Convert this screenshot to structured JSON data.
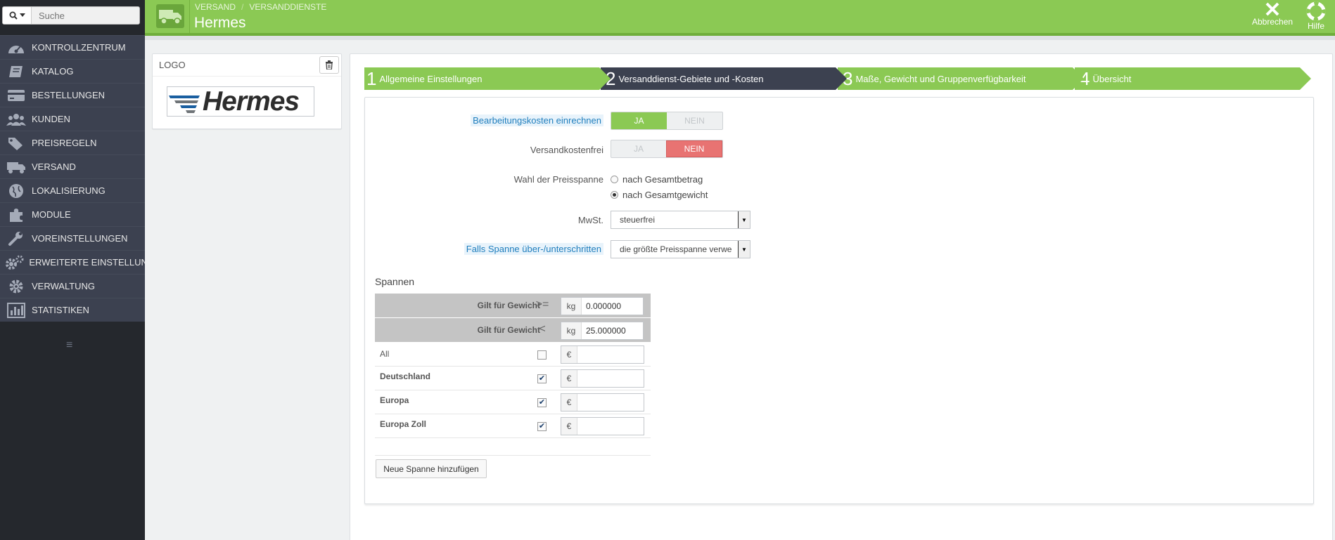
{
  "search": {
    "placeholder": "Suche"
  },
  "sidebar": {
    "items": [
      {
        "label": "KONTROLLZENTRUM",
        "icon": "dashboard-icon"
      },
      {
        "label": "KATALOG",
        "icon": "book-icon"
      },
      {
        "label": "BESTELLUNGEN",
        "icon": "credit-card-icon"
      },
      {
        "label": "KUNDEN",
        "icon": "users-icon"
      },
      {
        "label": "PREISREGELN",
        "icon": "tags-icon"
      },
      {
        "label": "VERSAND",
        "icon": "truck-icon"
      },
      {
        "label": "LOKALISIERUNG",
        "icon": "globe-icon"
      },
      {
        "label": "MODULE",
        "icon": "puzzle-icon"
      },
      {
        "label": "VOREINSTELLUNGEN",
        "icon": "wrench-icon"
      },
      {
        "label": "ERWEITERTE EINSTELLUN...",
        "icon": "cogs-icon"
      },
      {
        "label": "VERWALTUNG",
        "icon": "cog-icon"
      },
      {
        "label": "STATISTIKEN",
        "icon": "bar-chart-icon"
      }
    ]
  },
  "header": {
    "breadcrumb": [
      "VERSAND",
      "VERSANDDIENSTE"
    ],
    "title": "Hermes",
    "cancel_label": "Abbrechen",
    "help_label": "Hilfe"
  },
  "logo_panel": {
    "title": "LOGO",
    "logo_text": "Hermes"
  },
  "wizard": {
    "steps": [
      {
        "number": "1",
        "label": "Allgemeine Einstellungen"
      },
      {
        "number": "2",
        "label": "Versanddienst-Gebiete und -Kosten"
      },
      {
        "number": "3",
        "label": "Maße, Gewicht und Gruppenverfügbarkeit"
      },
      {
        "number": "4",
        "label": "Übersicht"
      }
    ],
    "active_step": 2
  },
  "form": {
    "handling_label": "Bearbeitungskosten einrechnen",
    "free_label": "Versandkostenfrei",
    "yes": "JA",
    "no": "NEIN",
    "handling_value": "JA",
    "free_value": "NEIN",
    "range_label": "Wahl der Preisspanne",
    "range_options": [
      "nach Gesamtbetrag",
      "nach Gesamtgewicht"
    ],
    "range_selected": "nach Gesamtgewicht",
    "tax_label": "MwSt.",
    "tax_value": "steuerfrei",
    "outofrange_label": "Falls Spanne über-/unterschritten",
    "outofrange_value": "die größte Preisspanne verwe"
  },
  "ranges": {
    "section_title": "Spannen",
    "header_rows": [
      {
        "label": "Gilt für Gewicht",
        "operator": ">=",
        "unit": "kg",
        "value": "0.000000"
      },
      {
        "label": "Gilt für Gewicht",
        "operator": "<",
        "unit": "kg",
        "value": "25.000000"
      }
    ],
    "zones": [
      {
        "name": "All",
        "checked": false,
        "currency": "€"
      },
      {
        "name": "Deutschland",
        "checked": true,
        "currency": "€"
      },
      {
        "name": "Europa",
        "checked": true,
        "currency": "€"
      },
      {
        "name": "Europa Zoll",
        "checked": true,
        "currency": "€"
      }
    ],
    "add_button": "Neue Spanne hinzufügen"
  },
  "colors": {
    "accent_green": "#8bc954",
    "active_step": "#3c4150",
    "no_red": "#e87372",
    "sidebar": "#25282d"
  }
}
